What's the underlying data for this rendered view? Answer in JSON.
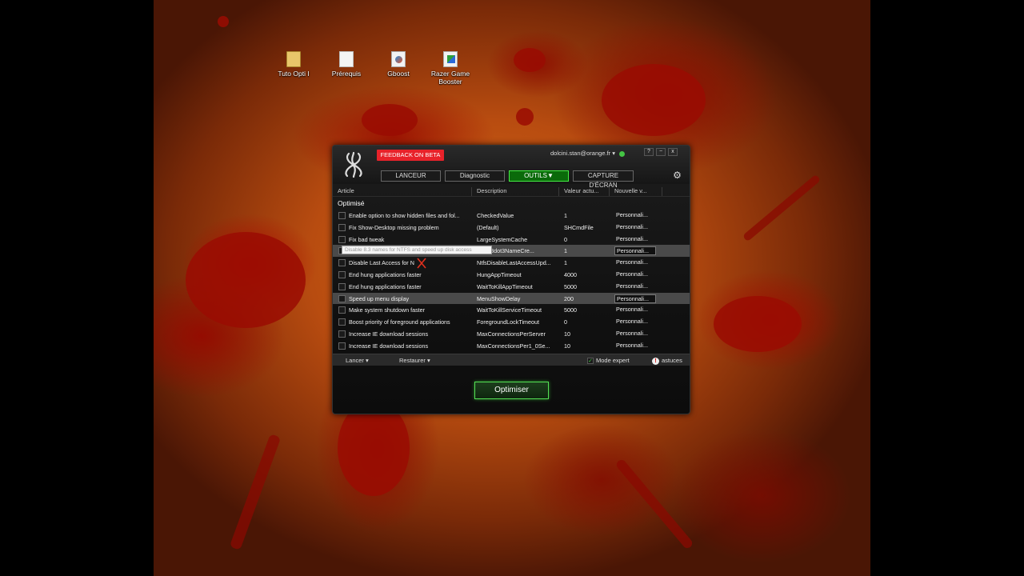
{
  "desktop": {
    "icons": [
      {
        "label": "Tuto Opti I",
        "icon": "folder-icon"
      },
      {
        "label": "Prérequis",
        "icon": "document-icon"
      },
      {
        "label": "Gboost",
        "icon": "gboost-app-icon"
      },
      {
        "label": "Razer Game Booster",
        "icon": "razer-game-booster-icon"
      }
    ]
  },
  "app": {
    "feedback_label": "FEEDBACK ON BETA",
    "account_email": "dolcini.stan@orange.fr",
    "status_color": "#44c544",
    "window_buttons": [
      "?",
      "−",
      "x"
    ],
    "tabs": [
      {
        "label": "LANCEUR",
        "active": false
      },
      {
        "label": "Diagnostic",
        "active": false
      },
      {
        "label": "OUTILS",
        "active": true
      },
      {
        "label": "CAPTURE D'ÉCRAN",
        "active": false
      }
    ],
    "accent_color": "#44ee44",
    "columns": [
      "Article",
      "Description",
      "Valeur actu...",
      "Nouvelle v..."
    ],
    "section_title": "Optimisé",
    "rows": [
      {
        "article": "Enable option to show hidden files and fol...",
        "description": "CheckedValue",
        "current": "1",
        "new": "Personnali..."
      },
      {
        "article": "Fix Show-Desktop missing problem",
        "description": "(Default)",
        "current": "SHCmdFile",
        "new": "Personnali..."
      },
      {
        "article": "Fix bad tweak",
        "description": "LargeSystemCache",
        "current": "0",
        "new": "Personnali..."
      },
      {
        "article": "",
        "description": "sable8dot3NameCre...",
        "current": "1",
        "new": "Personnali..."
      },
      {
        "article": "Disable Last Access for N",
        "description": "NtfsDisableLastAccessUpd...",
        "current": "1",
        "new": "Personnali..."
      },
      {
        "article": "End hung applications faster",
        "description": "HungAppTimeout",
        "current": "4000",
        "new": "Personnali..."
      },
      {
        "article": "End hung applications faster",
        "description": "WaitToKillAppTimeout",
        "current": "5000",
        "new": "Personnali..."
      },
      {
        "article": "Speed up menu display",
        "description": "MenuShowDelay",
        "current": "200",
        "new": "Personnali..."
      },
      {
        "article": "Make system shutdown faster",
        "description": "WaitToKillServiceTimeout",
        "current": "5000",
        "new": "Personnali..."
      },
      {
        "article": "Boost priority of foreground applications",
        "description": "ForegroundLockTimeout",
        "current": "0",
        "new": "Personnali..."
      },
      {
        "article": "Increase IE download sessions",
        "description": "MaxConnectionsPerServer",
        "current": "10",
        "new": "Personnali..."
      },
      {
        "article": "Increase IE download sessions",
        "description": "MaxConnectionsPer1_0Se...",
        "current": "10",
        "new": "Personnali..."
      }
    ],
    "tooltip": "Disable 8.3 names for NTFS and speed up disk access",
    "bottom": {
      "launch_label": "Lancer ▾",
      "restore_label": "Restaurer ▾",
      "expert_label": "Mode expert",
      "tips_label": "astuces"
    },
    "optimise_label": "Optimiser"
  }
}
